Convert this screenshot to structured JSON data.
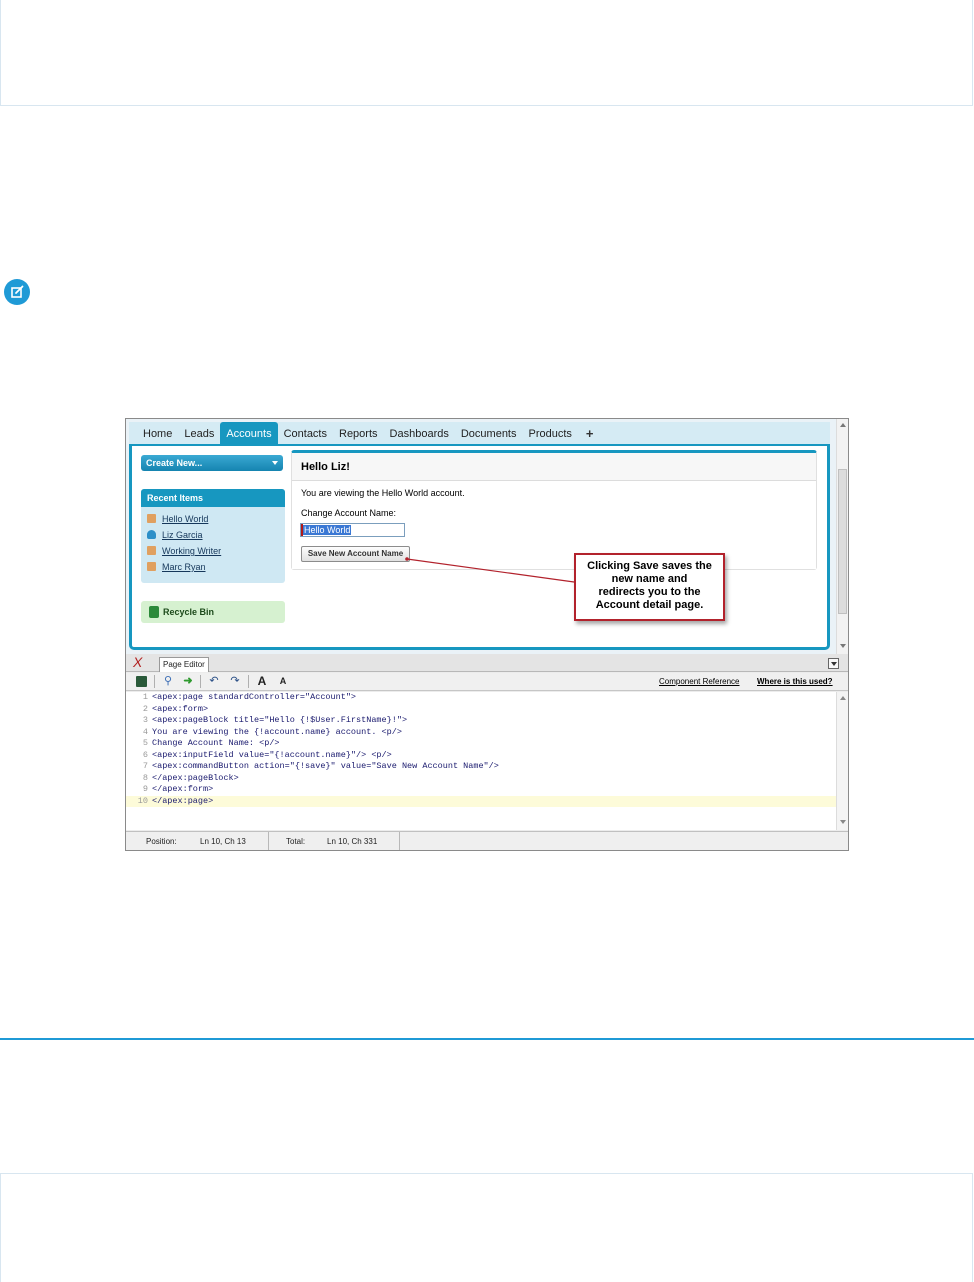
{
  "app": {
    "tabs": [
      {
        "label": "Home",
        "active": false
      },
      {
        "label": "Leads",
        "active": false
      },
      {
        "label": "Accounts",
        "active": true
      },
      {
        "label": "Contacts",
        "active": false
      },
      {
        "label": "Reports",
        "active": false
      },
      {
        "label": "Dashboards",
        "active": false
      },
      {
        "label": "Documents",
        "active": false
      },
      {
        "label": "Products",
        "active": false
      },
      {
        "label": "+",
        "active": false
      }
    ],
    "sidebar": {
      "create_new": "Create New...",
      "recent_title": "Recent Items",
      "recent_items": [
        {
          "label": "Hello World",
          "icon": "account-icon"
        },
        {
          "label": "Liz Garcia",
          "icon": "contact-icon"
        },
        {
          "label": "Working Writer",
          "icon": "account-icon"
        },
        {
          "label": "Marc Ryan",
          "icon": "account-icon"
        }
      ],
      "recycle_bin": "Recycle Bin"
    },
    "page_block": {
      "title": "Hello Liz!",
      "viewing_text": "You are viewing the Hello World account.",
      "change_label": "Change Account Name:",
      "input_value": "Hello World",
      "save_button": "Save New Account Name"
    },
    "callout": "Clicking Save saves the\nnew name and\nredirects you to the\nAccount detail page."
  },
  "editor": {
    "tab_label": "Page Editor",
    "links": {
      "component_reference": "Component Reference",
      "where_used": "Where is this used?"
    },
    "code_lines": [
      {
        "n": "1",
        "text": "<apex:page standardController=\"Account\">"
      },
      {
        "n": "2",
        "text": "<apex:form>"
      },
      {
        "n": "3",
        "text": "<apex:pageBlock title=\"Hello {!$User.FirstName}!\">"
      },
      {
        "n": "4",
        "text": "You are viewing the {!account.name} account. <p/>"
      },
      {
        "n": "5",
        "text": "Change Account Name: <p/>"
      },
      {
        "n": "6",
        "text": "<apex:inputField value=\"{!account.name}\"/> <p/>"
      },
      {
        "n": "7",
        "text": "<apex:commandButton action=\"{!save}\" value=\"Save New Account Name\"/>"
      },
      {
        "n": "8",
        "text": "</apex:pageBlock>"
      },
      {
        "n": "9",
        "text": "</apex:form>"
      },
      {
        "n": "10",
        "text": "</apex:page>"
      }
    ],
    "status": {
      "position_label": "Position:",
      "position_value": "Ln 10, Ch 13",
      "total_label": "Total:",
      "total_value": "Ln 10, Ch 331"
    }
  },
  "colors": {
    "accent": "#1797c0",
    "page_rule": "#1f9ad6",
    "callout_border": "#b2222c"
  }
}
